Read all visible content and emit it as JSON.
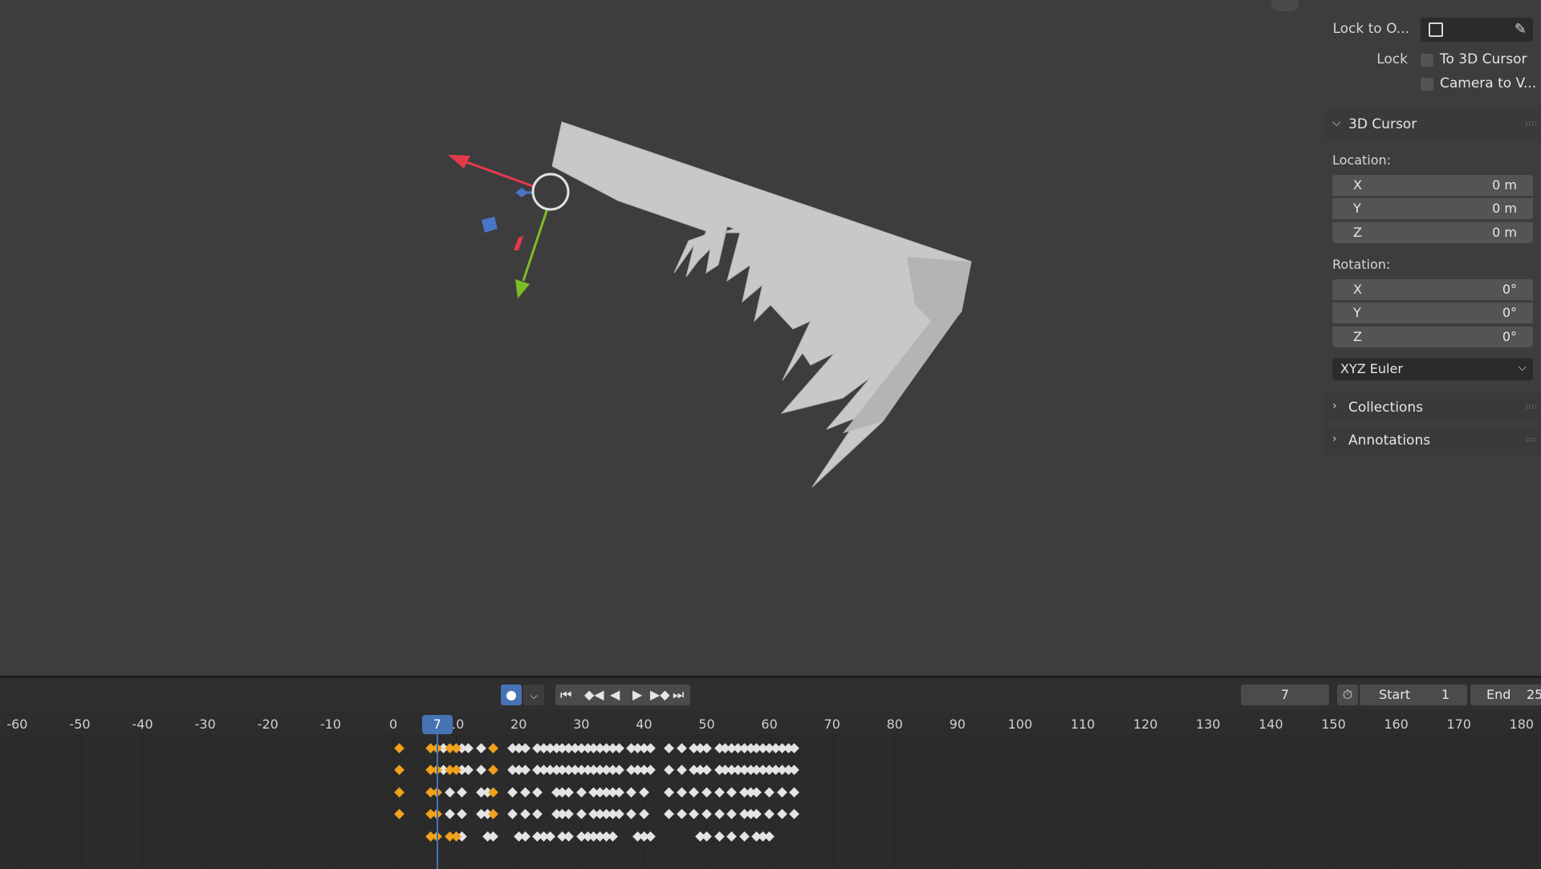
{
  "viewport": {
    "gizmo_colors": {
      "x": "#e53a4b",
      "y": "#7cbd25",
      "z": "#4a74c9"
    },
    "mesh_color": "#c8c8c8"
  },
  "npanel": {
    "lock_to_object_label": "Lock to O...",
    "lock_label": "Lock",
    "to_3d_cursor_label": "To 3D Cursor",
    "camera_to_view_label": "Camera to V...",
    "cursor_section": {
      "title": "3D Cursor",
      "location_label": "Location:",
      "location": [
        {
          "axis": "X",
          "value": "0 m"
        },
        {
          "axis": "Y",
          "value": "0 m"
        },
        {
          "axis": "Z",
          "value": "0 m"
        }
      ],
      "rotation_label": "Rotation:",
      "rotation": [
        {
          "axis": "X",
          "value": "0°"
        },
        {
          "axis": "Y",
          "value": "0°"
        },
        {
          "axis": "Z",
          "value": "0°"
        }
      ],
      "rotation_mode": "XYZ Euler"
    },
    "collections_title": "Collections",
    "annotations_title": "Annotations"
  },
  "timeline": {
    "current_frame": "7",
    "start_label": "Start",
    "start_value": "1",
    "end_label": "End",
    "end_value": "25",
    "ruler_ticks": [
      "-60",
      "-50",
      "-40",
      "-30",
      "-20",
      "-10",
      "0",
      "10",
      "20",
      "30",
      "40",
      "50",
      "60",
      "70",
      "80",
      "90",
      "100",
      "110",
      "120",
      "130",
      "140",
      "150",
      "160",
      "170",
      "180"
    ],
    "playhead_frame": 7,
    "keyframe_rows": [
      {
        "orange": [
          1,
          6,
          7,
          9,
          10,
          16
        ],
        "white": [
          8,
          11,
          12,
          14,
          19,
          20,
          21,
          23,
          24,
          25,
          26,
          27,
          28,
          29,
          30,
          31,
          32,
          33,
          34,
          35,
          36,
          38,
          39,
          40,
          41,
          44,
          46,
          48,
          49,
          50,
          52,
          53,
          54,
          55,
          56,
          57,
          58,
          59,
          60,
          61,
          62,
          63,
          64
        ]
      },
      {
        "orange": [
          1,
          6,
          7,
          9,
          10,
          16
        ],
        "white": [
          8,
          11,
          12,
          14,
          19,
          20,
          21,
          23,
          24,
          25,
          26,
          27,
          28,
          29,
          30,
          31,
          32,
          33,
          34,
          35,
          36,
          38,
          39,
          40,
          41,
          44,
          46,
          48,
          49,
          50,
          52,
          53,
          54,
          55,
          56,
          57,
          58,
          59,
          60,
          61,
          62,
          63,
          64
        ]
      },
      {
        "orange": [
          1,
          6,
          7,
          16
        ],
        "white": [
          9,
          11,
          14,
          15,
          19,
          21,
          23,
          26,
          27,
          28,
          30,
          32,
          33,
          34,
          35,
          36,
          38,
          40,
          44,
          46,
          48,
          50,
          52,
          54,
          56,
          57,
          58,
          60,
          62,
          64
        ]
      },
      {
        "orange": [
          1,
          6,
          7,
          16
        ],
        "white": [
          9,
          11,
          14,
          15,
          19,
          21,
          23,
          26,
          27,
          28,
          30,
          32,
          33,
          34,
          35,
          36,
          38,
          40,
          44,
          46,
          48,
          50,
          52,
          54,
          56,
          57,
          58,
          60,
          62,
          64
        ]
      },
      {
        "orange": [
          6,
          7,
          9,
          10
        ],
        "white": [
          11,
          15,
          16,
          20,
          21,
          23,
          24,
          25,
          27,
          28,
          30,
          31,
          32,
          33,
          34,
          35,
          39,
          40,
          41,
          49,
          50,
          52,
          54,
          56,
          58,
          59,
          60
        ]
      }
    ]
  }
}
